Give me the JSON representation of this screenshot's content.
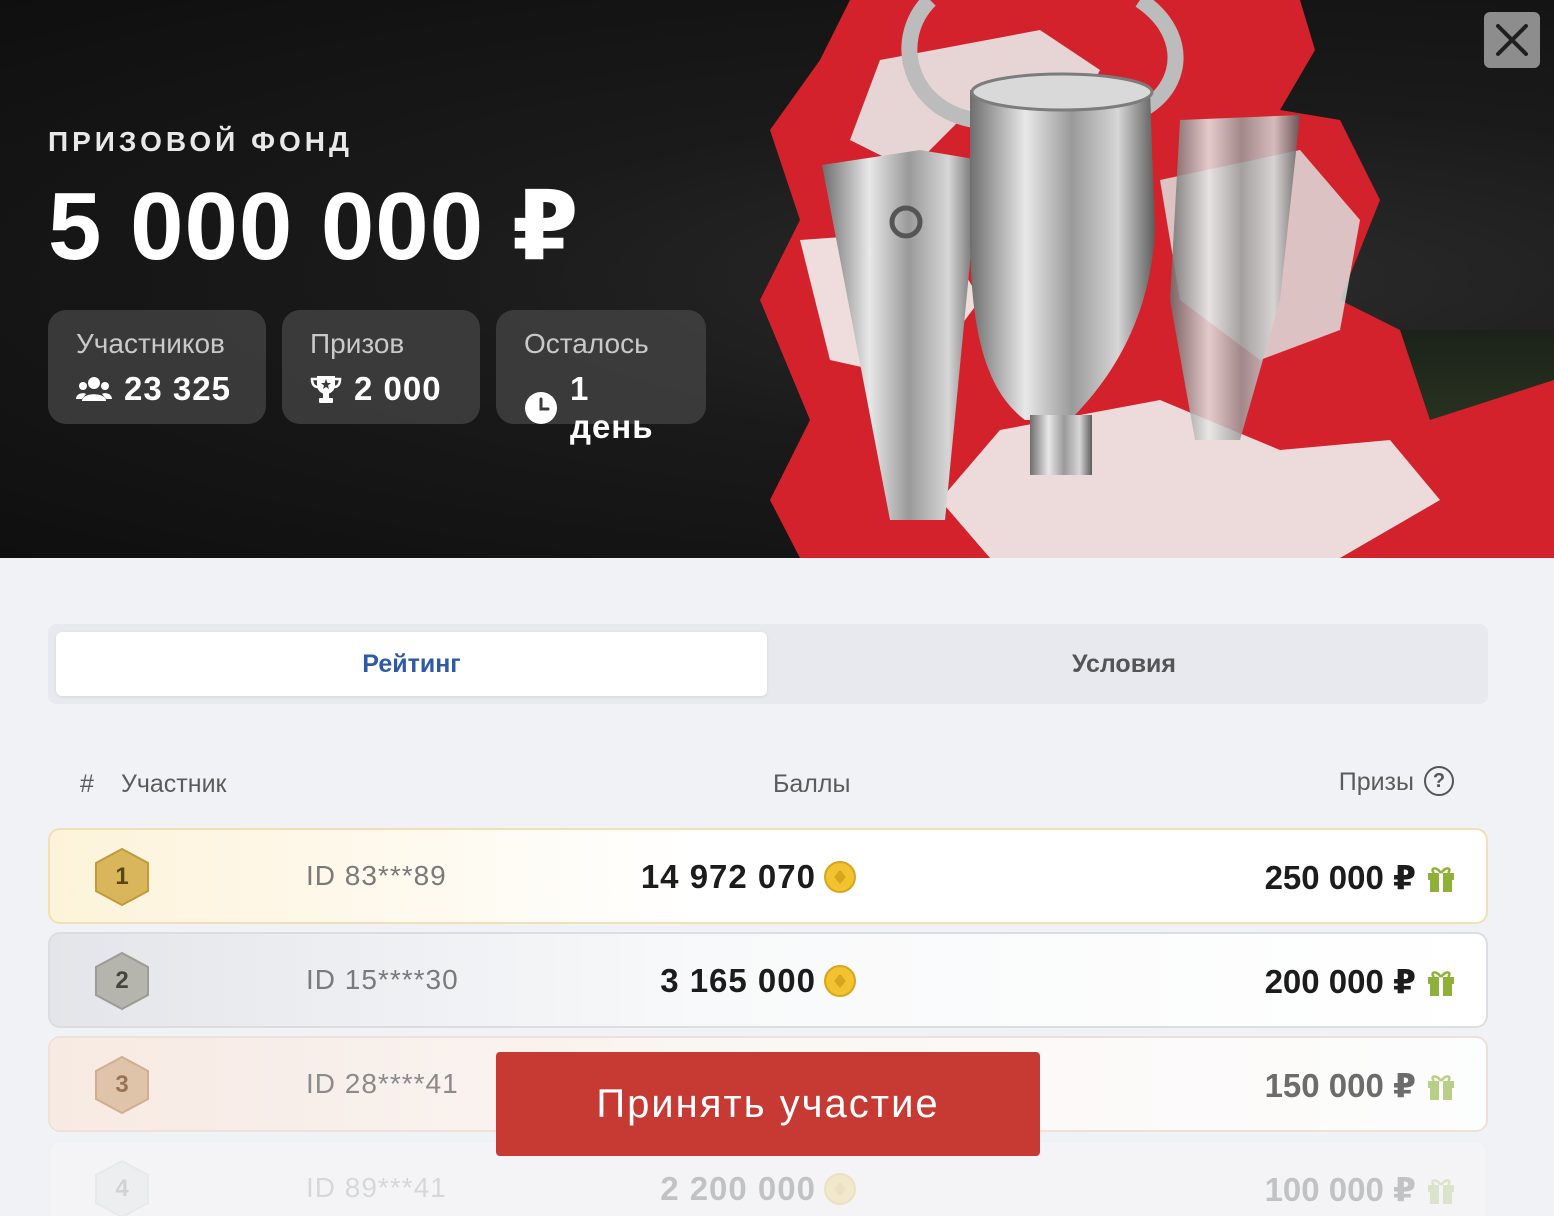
{
  "hero": {
    "label": "ПРИЗОВОЙ ФОНД",
    "amount": "5 000 000 ₽",
    "stats": [
      {
        "title": "Участников",
        "value": "23 325",
        "icon": "users-icon"
      },
      {
        "title": "Призов",
        "value": "2 000",
        "icon": "trophy-icon"
      },
      {
        "title": "Осталось",
        "value": "1 день",
        "icon": "clock-icon"
      }
    ],
    "close_icon": "close-icon"
  },
  "tabs": [
    {
      "label": "Рейтинг",
      "active": true
    },
    {
      "label": "Условия",
      "active": false
    }
  ],
  "table": {
    "headers": {
      "hash": "#",
      "participant": "Участник",
      "points": "Баллы",
      "prizes": "Призы",
      "help": "?"
    },
    "rows": [
      {
        "rank": "1",
        "id": "ID 83***89",
        "points": "14 972 070",
        "prize": "250 000 ₽"
      },
      {
        "rank": "2",
        "id": "ID 15****30",
        "points": "3 165 000",
        "prize": "200 000 ₽"
      },
      {
        "rank": "3",
        "id": "ID 28****41",
        "points": "",
        "prize": "150 000 ₽"
      },
      {
        "rank": "4",
        "id": "ID 89***41",
        "points": "2 200 000",
        "prize": "100 000 ₽"
      }
    ]
  },
  "cta": {
    "label": "Принять участие"
  },
  "colors": {
    "accent": "#c73a34",
    "tab_active_text": "#2e5aa8",
    "gold": "#d4ae4f",
    "silver": "#a8a8a3",
    "bronze": "#d7b290",
    "gift": "#8fb13a"
  }
}
